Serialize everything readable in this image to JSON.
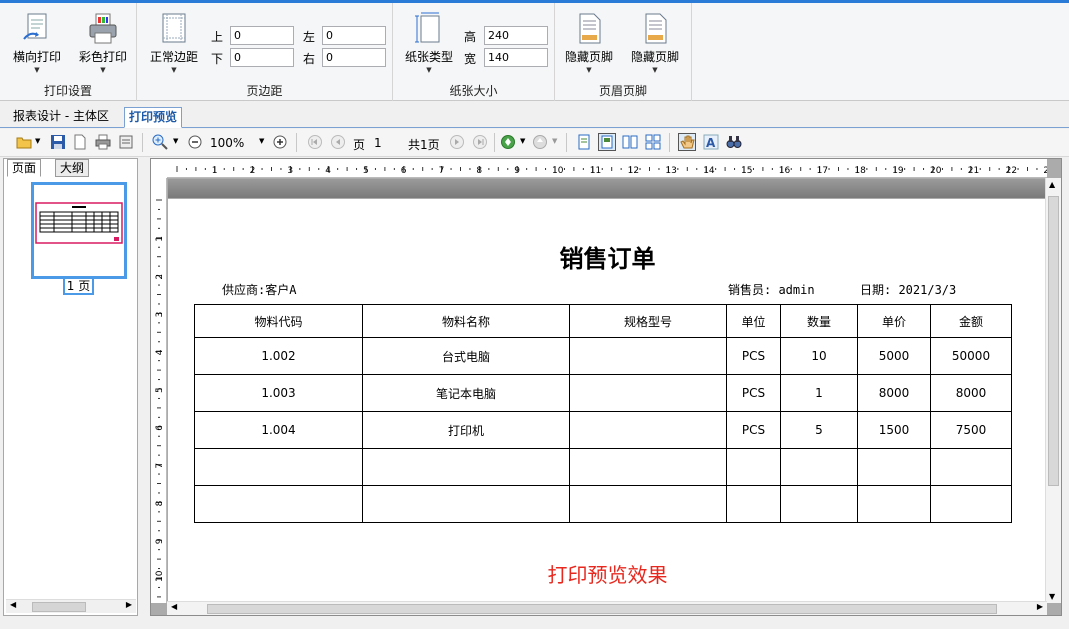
{
  "ribbon": {
    "print_settings": {
      "caption": "打印设置",
      "landscape_label": "横向打印",
      "color_label": "彩色打印"
    },
    "margins": {
      "caption": "页边距",
      "normal_label": "正常边距",
      "top_label": "上",
      "top_value": "0",
      "bottom_label": "下",
      "bottom_value": "0",
      "left_label": "左",
      "left_value": "0",
      "right_label": "右",
      "right_value": "0"
    },
    "paper": {
      "caption": "纸张大小",
      "type_label": "纸张类型",
      "height_label": "高",
      "height_value": "240",
      "width_label": "宽",
      "width_value": "140"
    },
    "header_footer": {
      "caption": "页眉页脚",
      "hide_footer_label": "隐藏页脚",
      "hide_footer2_label": "隐藏页脚"
    }
  },
  "tabs": [
    {
      "label": "报表设计 - 主体区"
    },
    {
      "label": "打印预览"
    }
  ],
  "toolbar": {
    "zoom": "100%",
    "page_label": "页",
    "page_value": "1",
    "total_label": "共1页"
  },
  "left_panel": {
    "tab_pages": "页面",
    "tab_outline": "大纲",
    "page_caption": "1 页"
  },
  "ruler": {
    "h_ticks": [
      "1",
      "2",
      "3",
      "4",
      "5",
      "6",
      "7",
      "8",
      "9",
      "10",
      "11",
      "12",
      "13",
      "14",
      "15",
      "16",
      "17",
      "18",
      "19",
      "20",
      "21",
      "22",
      "23"
    ],
    "v_ticks": [
      "1",
      "2",
      "3",
      "4",
      "5",
      "6",
      "7",
      "8",
      "9",
      "10"
    ]
  },
  "report": {
    "title": "销售订单",
    "supplier": "供应商:客户A",
    "salesman": "销售员: admin",
    "date": "日期: 2021/3/3",
    "columns": [
      "物料代码",
      "物料名称",
      "规格型号",
      "单位",
      "数量",
      "单价",
      "金额"
    ],
    "rows": [
      [
        "1.002",
        "台式电脑",
        "",
        "PCS",
        "10",
        "5000",
        "50000"
      ],
      [
        "1.003",
        "笔记本电脑",
        "",
        "PCS",
        "1",
        "8000",
        "8000"
      ],
      [
        "1.004",
        "打印机",
        "",
        "PCS",
        "5",
        "1500",
        "7500"
      ],
      [
        "",
        "",
        "",
        "",
        "",
        "",
        ""
      ],
      [
        "",
        "",
        "",
        "",
        "",
        "",
        ""
      ]
    ],
    "footer_text": "打印预览效果"
  },
  "colors": {
    "accent": "#2a7ad8",
    "thumb_border": "#4a9ae8",
    "effect_text": "#e8281e"
  }
}
